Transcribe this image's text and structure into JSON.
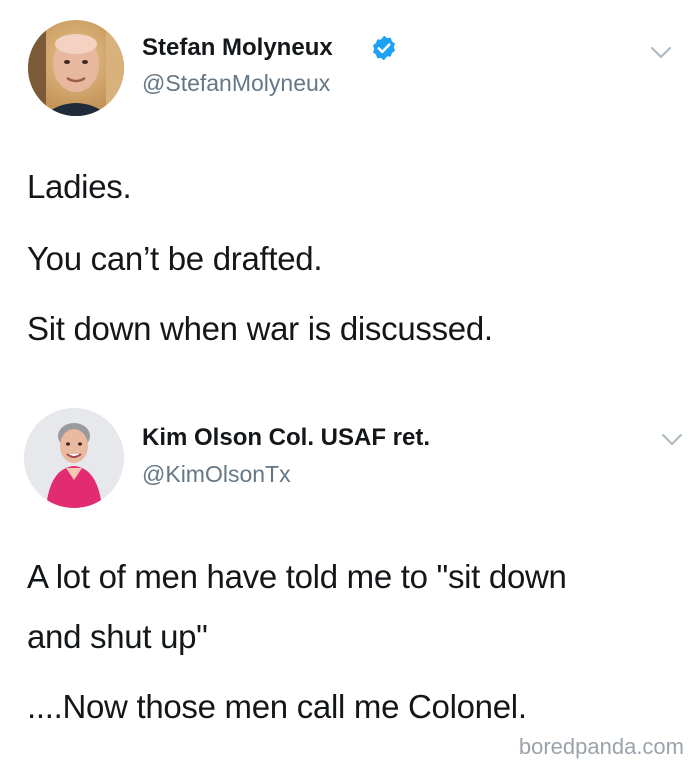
{
  "tweets": [
    {
      "author": {
        "display_name": "Stefan Molyneux",
        "handle": "@StefanMolyneux",
        "verified": true,
        "avatar_icon": "avatar-photo-man"
      },
      "lines": [
        "Ladies.",
        "You can’t be drafted.",
        "Sit down when war is discussed."
      ]
    },
    {
      "author": {
        "display_name": "Kim Olson Col. USAF ret.",
        "handle": "@KimOlsonTx",
        "verified": false,
        "avatar_icon": "avatar-photo-woman"
      },
      "lines": [
        "A lot of men have told me to \"sit down",
        "and shut up\"",
        "....Now those men call me Colonel."
      ]
    }
  ],
  "watermark": "boredpanda.com",
  "colors": {
    "text": "#14171a",
    "secondary_text": "#657786",
    "verified_badge": "#1da1f2",
    "chevron": "#aab8c2"
  }
}
